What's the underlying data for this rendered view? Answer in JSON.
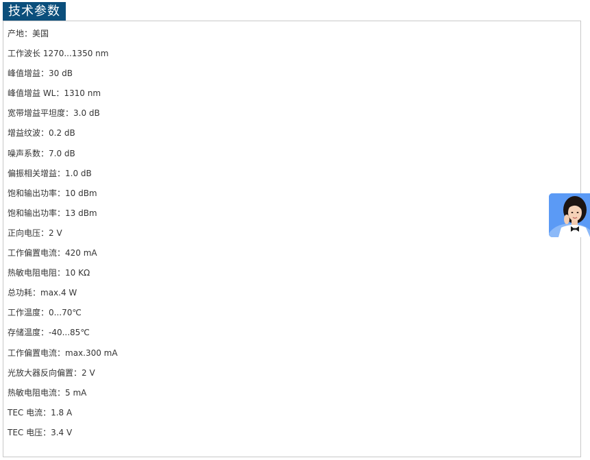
{
  "section": {
    "title": "技术参数"
  },
  "specs": [
    "产地：美国",
    "工作波长 1270...1350 nm",
    "峰值增益：30 dB",
    "峰值增益 WL：1310 nm",
    "宽带增益平坦度：3.0 dB",
    "增益纹波：0.2 dB",
    "噪声系数：7.0 dB",
    "偏振相关增益：1.0 dB",
    "饱和输出功率：10 dBm",
    "饱和输出功率：13 dBm",
    "正向电压：2 V",
    "工作偏置电流：420 mA",
    "热敏电阻电阻：10 KΩ",
    "总功耗：max.4 W",
    "工作温度：0...70℃",
    "存储温度：-40...85℃",
    "工作偏置电流：max.300 mA",
    "光放大器反向偏置：2 V",
    "热敏电阻电流：5 mA",
    "TEC 电流：1.8 A",
    "TEC 电压：3.4 V"
  ],
  "chat_widget": {
    "icon": "customer-service-avatar-icon",
    "color": "#4d8ff0"
  },
  "colors": {
    "tab_background": "#0b4f7c",
    "panel_border": "#c8c8c8",
    "text": "#333333"
  }
}
